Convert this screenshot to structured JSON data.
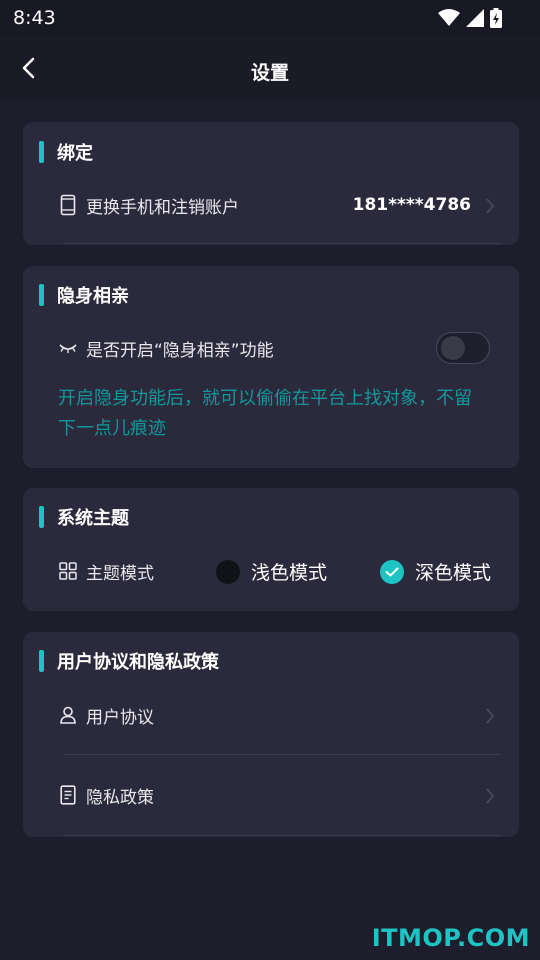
{
  "status_bar": {
    "time": "8:43"
  },
  "header": {
    "title": "设置"
  },
  "binding": {
    "title": "绑定",
    "row_label": "更换手机和注销账户",
    "phone": "181****4786"
  },
  "stealth": {
    "title": "隐身相亲",
    "row_label": "是否开启“隐身相亲”功能",
    "toggle_on": false,
    "hint": "开启隐身功能后，就可以偷偷在平台上找对象，不留下一点儿痕迹"
  },
  "theme": {
    "title": "系统主题",
    "row_label": "主题模式",
    "options": [
      {
        "label": "浅色模式",
        "selected": false
      },
      {
        "label": "深色模式",
        "selected": true
      }
    ]
  },
  "policy": {
    "title": "用户协议和隐私政策",
    "items": [
      {
        "label": "用户协议"
      },
      {
        "label": "隐私政策"
      }
    ]
  },
  "watermark": "ITMOP.COM",
  "colors": {
    "accent": "#1ec4c4",
    "hint_text": "#12979a",
    "background": "#1e1d2b",
    "card": "#2b2a3c"
  }
}
